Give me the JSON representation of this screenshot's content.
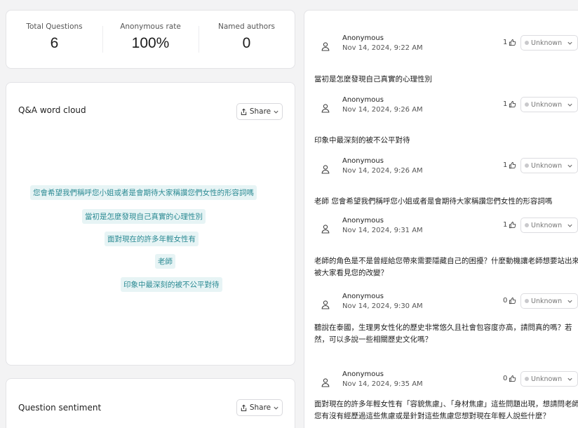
{
  "stats": {
    "total_questions_label": "Total Questions",
    "total_questions_value": "6",
    "anonymous_rate_label": "Anonymous rate",
    "anonymous_rate_value": "100%",
    "named_authors_label": "Named authors",
    "named_authors_value": "0"
  },
  "word_cloud": {
    "title": "Q&A word cloud",
    "share_label": "Share",
    "words": [
      "您會希望我們稱呼您小姐或者是會期待大家稱讚您們女性的形容詞嗎",
      "當初是怎麼發現自己真實的心理性別",
      "面對現在的許多年輕女性有",
      "老師",
      "印象中最深刻的被不公平對待"
    ]
  },
  "sentiment": {
    "title": "Question sentiment",
    "share_label": "Share"
  },
  "questions": [
    {
      "author": "Anonymous",
      "date": "Nov 14, 2024, 9:22 AM",
      "likes": "1",
      "status": "Unknown",
      "text": "當初是怎麼發現自己真實的心理性別"
    },
    {
      "author": "Anonymous",
      "date": "Nov 14, 2024, 9:26 AM",
      "likes": "1",
      "status": "Unknown",
      "text": "印象中最深刻的被不公平對待"
    },
    {
      "author": "Anonymous",
      "date": "Nov 14, 2024, 9:26 AM",
      "likes": "1",
      "status": "Unknown",
      "text": "老師 您會希望我們稱呼您小姐或者是會期待大家稱讚您們女性的形容詞嗎"
    },
    {
      "author": "Anonymous",
      "date": "Nov 14, 2024, 9:31 AM",
      "likes": "1",
      "status": "Unknown",
      "text": "老師的角色是不是曾經給您帶來需要隱藏自己的困擾？什麼動機讓老師想要站出來被大家看見您的改變？"
    },
    {
      "author": "Anonymous",
      "date": "Nov 14, 2024, 9:30 AM",
      "likes": "0",
      "status": "Unknown",
      "text": "聽說在泰國，生理男女性化的歷史非常悠久且社會包容度亦高，請問真的嗎？若然，可以多說一些相關歷史文化嗎？"
    },
    {
      "author": "Anonymous",
      "date": "Nov 14, 2024, 9:35 AM",
      "likes": "0",
      "status": "Unknown",
      "text": "面對現在的許多年輕女性有「容貌焦慮」、「身材焦慮」這些問題出現，想請問老師您有沒有經歷過這些焦慮或是針對這些焦慮您想對現在年輕人說些什麼？"
    }
  ],
  "icons": {
    "avatar": "person-icon",
    "like": "thumbs-up-icon",
    "share": "share-icon",
    "dropdown": "chevron-down-icon"
  },
  "colors": {
    "word_cloud_text": "#2b8a93",
    "word_cloud_bg": "#e7f4f5",
    "status_dot": "#c9c9cc"
  }
}
